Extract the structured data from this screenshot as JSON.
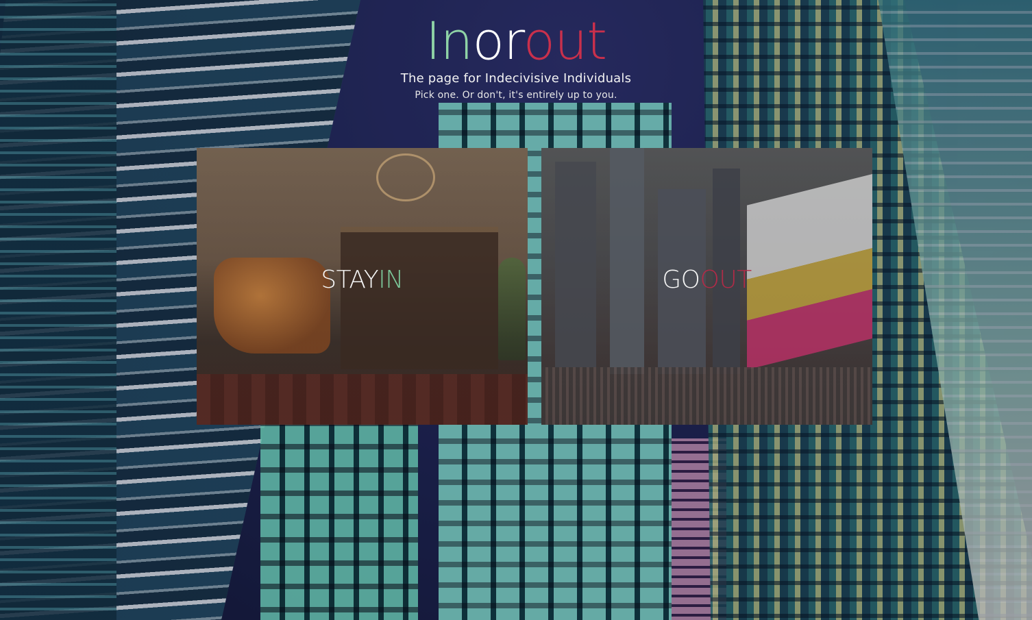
{
  "header": {
    "logo_part1": "In",
    "logo_part2": "or",
    "logo_part3": "out",
    "tagline": "The page for Indecivisive Individuals",
    "subtitle": "Pick one. Or don't, it's entirely up to you."
  },
  "cards": [
    {
      "id": "stay-in",
      "label_main": "STAY",
      "label_accent": "IN",
      "accent_color": "#7cc89a"
    },
    {
      "id": "go-out",
      "label_main": "GO",
      "label_accent": "OUT",
      "accent_color": "#b02b47"
    }
  ],
  "colors": {
    "logo_green": "#8fd3a6",
    "logo_white": "#ffffff",
    "logo_red": "#c9304c"
  }
}
